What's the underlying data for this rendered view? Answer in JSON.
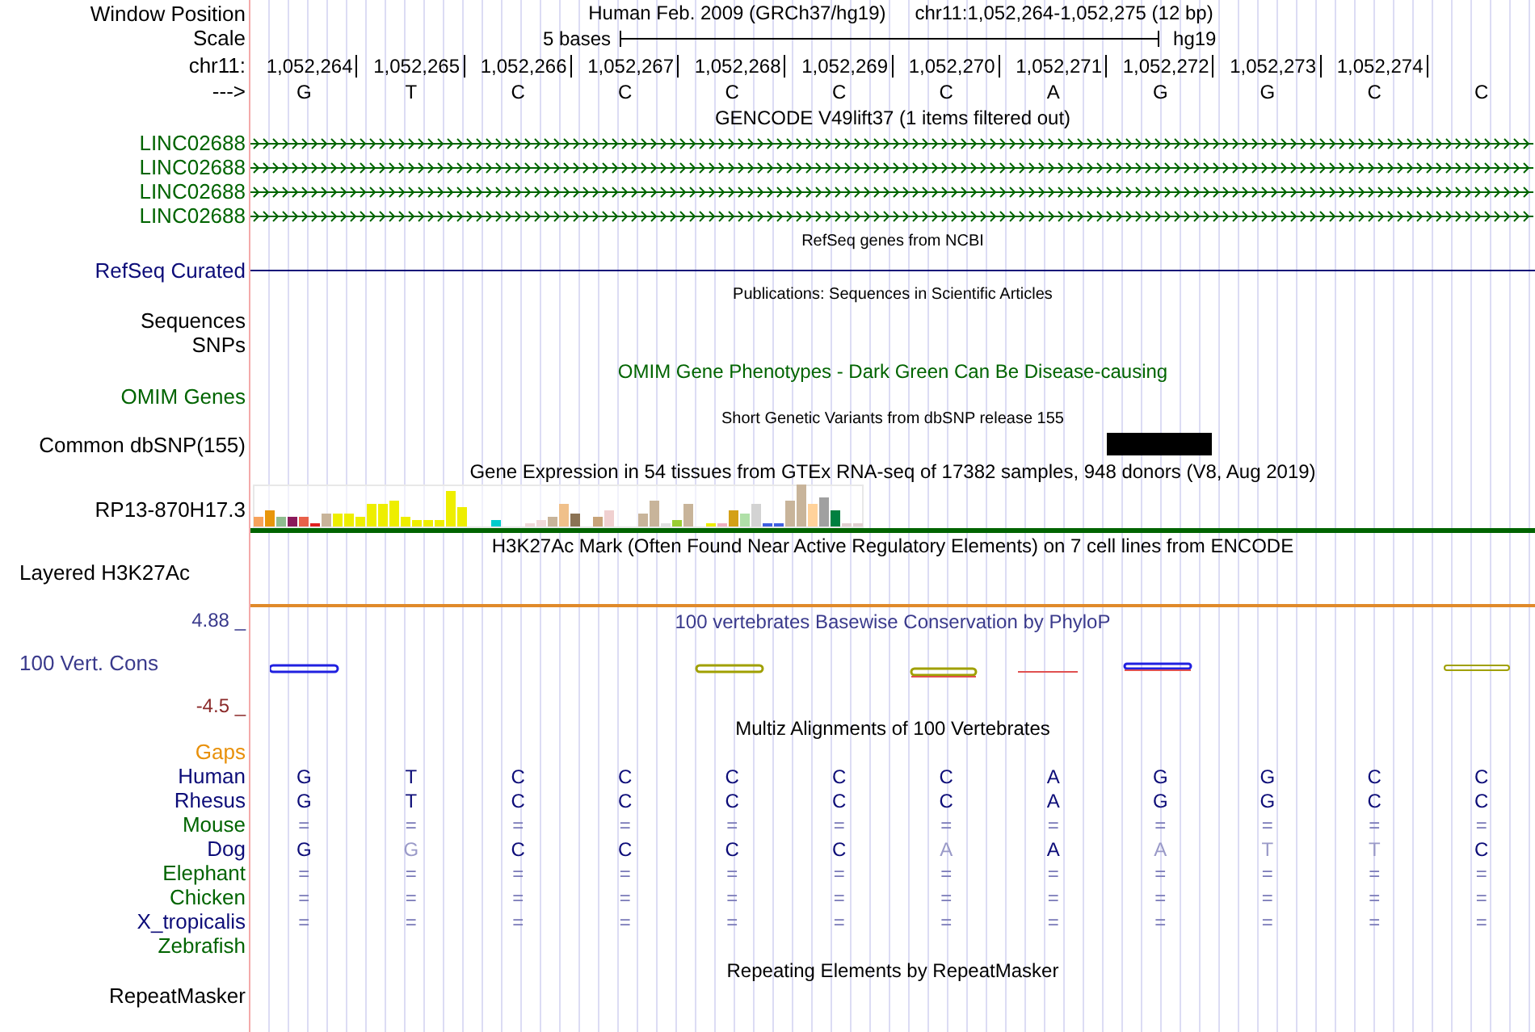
{
  "header": {
    "position_label": "Window Position",
    "assembly": "Human Feb. 2009 (GRCh37/hg19)",
    "range": "chr11:1,052,264-1,052,275 (12 bp)",
    "scale_label": "Scale",
    "scale_text": "5 bases",
    "db": "hg19",
    "chrom_label": "chr11:",
    "positions": [
      "1,052,264",
      "1,052,265",
      "1,052,266",
      "1,052,267",
      "1,052,268",
      "1,052,269",
      "1,052,270",
      "1,052,271",
      "1,052,272",
      "1,052,273",
      "1,052,274"
    ],
    "strand_label": "--->",
    "bases": [
      "G",
      "T",
      "C",
      "C",
      "C",
      "C",
      "C",
      "A",
      "G",
      "G",
      "C",
      "C"
    ]
  },
  "tracks": [
    {
      "kind": "gene",
      "title": "GENCODE V49lift37 (1 items filtered out)",
      "items": [
        {
          "label": "LINC02688",
          "color": "#006400"
        },
        {
          "label": "LINC02688",
          "color": "#006400"
        },
        {
          "label": "LINC02688",
          "color": "#006400"
        },
        {
          "label": "LINC02688",
          "color": "#006400"
        }
      ]
    },
    {
      "kind": "line",
      "title": "RefSeq genes from NCBI",
      "label": "RefSeq Curated",
      "color": "#0c0c78"
    },
    {
      "kind": "empty",
      "title": "Publications: Sequences in Scientific Articles",
      "labels": [
        "Sequences",
        "SNPs"
      ]
    },
    {
      "kind": "omim",
      "title": "OMIM Gene Phenotypes - Dark Green Can Be Disease-causing",
      "label": "OMIM Genes",
      "color": "#006400"
    },
    {
      "kind": "snp",
      "title": "Short Genetic Variants from dbSNP release 155",
      "label": "Common dbSNP(155)"
    },
    {
      "kind": "expression",
      "title": "Gene Expression in 54 tissues from GTEx RNA-seq of 17382 samples, 948 donors (V8, Aug 2019)",
      "label": "RP13-870H17.3"
    },
    {
      "kind": "signal",
      "title": "H3K27Ac Mark (Often Found Near Active Regulatory Elements) on 7 cell lines from ENCODE",
      "label": "Layered H3K27Ac"
    },
    {
      "kind": "conservation",
      "title": "100 vertebrates Basewise Conservation by PhyloP",
      "label": "100 Vert. Cons",
      "color": "#3a3a8c",
      "max": "4.88 _",
      "min": "-4.5 _"
    },
    {
      "kind": "alignment",
      "title": "Multiz Alignments of 100 Vertebrates",
      "species": [
        {
          "name": "Gaps",
          "color": "#e8900a"
        },
        {
          "name": "Human",
          "color": "#0c0c78",
          "bases": [
            "G",
            "T",
            "C",
            "C",
            "C",
            "C",
            "C",
            "A",
            "G",
            "G",
            "C",
            "C"
          ]
        },
        {
          "name": "Rhesus",
          "color": "#0c0c78",
          "bases": [
            "G",
            "T",
            "C",
            "C",
            "C",
            "C",
            "C",
            "A",
            "G",
            "G",
            "C",
            "C"
          ]
        },
        {
          "name": "Mouse",
          "color": "#006400",
          "bases": [
            "=",
            "=",
            "=",
            "=",
            "=",
            "=",
            "=",
            "=",
            "=",
            "=",
            "=",
            "="
          ]
        },
        {
          "name": "Dog",
          "color": "#0c0c78",
          "bases": [
            "G",
            "G",
            "C",
            "C",
            "C",
            "C",
            "A",
            "A",
            "A",
            "T",
            "T",
            "C"
          ],
          "faded": [
            false,
            true,
            false,
            false,
            false,
            false,
            true,
            false,
            true,
            true,
            true,
            false
          ]
        },
        {
          "name": "Elephant",
          "color": "#006400",
          "bases": [
            "=",
            "=",
            "=",
            "=",
            "=",
            "=",
            "=",
            "=",
            "=",
            "=",
            "=",
            "="
          ]
        },
        {
          "name": "Chicken",
          "color": "#006400",
          "bases": [
            "=",
            "=",
            "=",
            "=",
            "=",
            "=",
            "=",
            "=",
            "=",
            "=",
            "=",
            "="
          ]
        },
        {
          "name": "X_tropicalis",
          "color": "#0c0c78",
          "bases": [
            "=",
            "=",
            "=",
            "=",
            "=",
            "=",
            "=",
            "=",
            "=",
            "=",
            "=",
            "="
          ]
        },
        {
          "name": "Zebrafish",
          "color": "#006400"
        }
      ]
    },
    {
      "kind": "repeats",
      "title": "Repeating Elements by RepeatMasker",
      "label": "RepeatMasker"
    }
  ]
}
